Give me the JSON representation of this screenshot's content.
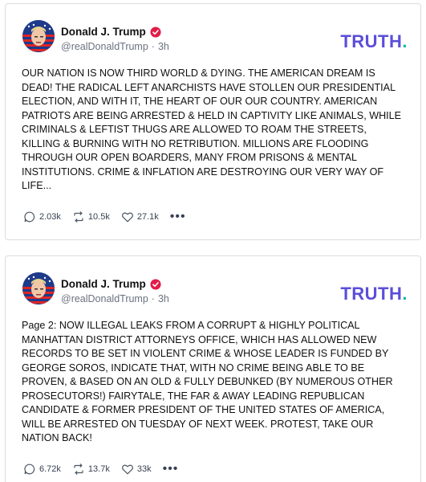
{
  "posts": [
    {
      "author": "Donald J. Trump",
      "handle": "@realDonaldTrump",
      "separator": "·",
      "time": "3h",
      "logo": "TRUTH",
      "logo_dot": ".",
      "text": "OUR NATION IS NOW THIRD WORLD & DYING. THE AMERICAN DREAM IS DEAD! THE RADICAL LEFT ANARCHISTS HAVE STOLLEN  OUR PRESIDENTIAL ELECTION, AND WITH IT, THE HEART OF OUR OUR COUNTRY. AMERICAN PATRIOTS ARE BEING ARRESTED & HELD IN CAPTIVITY LIKE ANIMALS, WHILE CRIMINALS & LEFTIST THUGS ARE ALLOWED TO ROAM THE STREETS, KILLING & BURNING WITH NO RETRIBUTION. MILLIONS ARE FLOODING THROUGH OUR OPEN BOARDERS, MANY FROM PRISONS & MENTAL INSTITUTIONS. CRIME & INFLATION ARE DESTROYING OUR VERY WAY OF LIFE...",
      "replies": "2.03k",
      "retruths": "10.5k",
      "likes": "27.1k",
      "more": "•••"
    },
    {
      "author": "Donald J. Trump",
      "handle": "@realDonaldTrump",
      "separator": "·",
      "time": "3h",
      "logo": "TRUTH",
      "logo_dot": ".",
      "text": "Page 2: NOW ILLEGAL LEAKS FROM A CORRUPT & HIGHLY POLITICAL MANHATTAN DISTRICT ATTORNEYS OFFICE, WHICH HAS ALLOWED NEW RECORDS TO BE SET IN VIOLENT CRIME & WHOSE LEADER IS FUNDED BY GEORGE SOROS, INDICATE THAT, WITH NO CRIME BEING ABLE TO BE PROVEN, & BASED ON AN OLD & FULLY DEBUNKED (BY NUMEROUS OTHER PROSECUTORS!) FAIRYTALE, THE FAR & AWAY LEADING REPUBLICAN CANDIDATE & FORMER PRESIDENT OF THE UNITED STATES OF AMERICA, WILL BE ARRESTED ON TUESDAY OF NEXT WEEK. PROTEST, TAKE OUR NATION BACK!",
      "replies": "6.72k",
      "retruths": "13.7k",
      "likes": "33k",
      "more": "•••"
    }
  ],
  "colors": {
    "logo": "#5b4ed8",
    "logo_dot": "#14b8a6",
    "verified": "#e11d48"
  }
}
